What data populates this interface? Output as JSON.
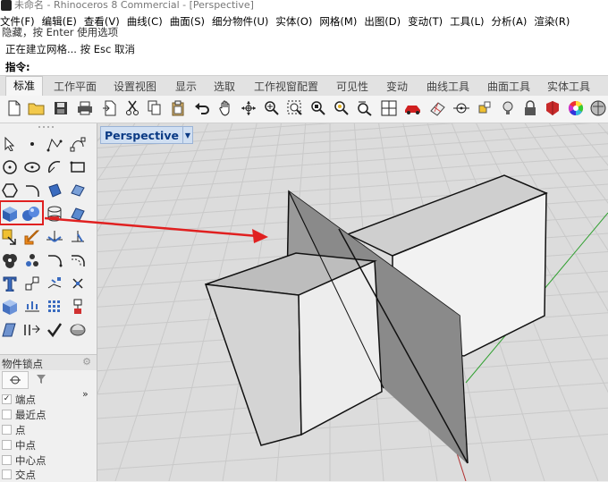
{
  "window": {
    "title": "未命名 - Rhinoceros 8 Commercial - [Perspective]"
  },
  "menu": [
    "文件(F)",
    "编辑(E)",
    "查看(V)",
    "曲线(C)",
    "曲面(S)",
    "细分物件(U)",
    "实体(O)",
    "网格(M)",
    "出图(D)",
    "变动(T)",
    "工具(L)",
    "分析(A)",
    "渲染(R)"
  ],
  "command": {
    "history_1": "隐藏，按 Enter 使用选项",
    "history_2": "正在建立网格... 按 Esc 取消",
    "prompt": "指令:"
  },
  "tabs": [
    "标准",
    "工作平面",
    "设置视图",
    "显示",
    "选取",
    "工作视窗配置",
    "可见性",
    "变动",
    "曲线工具",
    "曲面工具",
    "实体工具"
  ],
  "toolbar_icons": [
    "new-file-icon",
    "open-folder-icon",
    "save-icon",
    "print-icon",
    "import-icon",
    "cut-icon",
    "copy-icon",
    "paste-icon",
    "undo-icon",
    "pan-hand-icon",
    "rotate-view-icon",
    "zoom-icon",
    "zoom-window-icon",
    "zoom-extents-icon",
    "zoom-selected-icon",
    "four-viewports-icon",
    "car-icon",
    "grid-icon",
    "cplane-icon",
    "osnap-icon",
    "light-bulb-icon",
    "lock-icon",
    "material-icon",
    "color-wheel-icon",
    "render-sphere-icon"
  ],
  "object_snap": {
    "title": "物件锁点",
    "options": [
      {
        "label": "端点",
        "checked": true
      },
      {
        "label": "最近点",
        "checked": false
      },
      {
        "label": "点",
        "checked": false
      },
      {
        "label": "中点",
        "checked": false
      },
      {
        "label": "中心点",
        "checked": false
      },
      {
        "label": "交点",
        "checked": false
      }
    ],
    "more": "»"
  },
  "viewport": {
    "name": "Perspective"
  },
  "colors": {
    "viewport_bg": "#dcdcdc",
    "grid_line": "#c9c9c9",
    "axis_x": "#b03030",
    "axis_y": "#30a030",
    "annotation": "#e02020",
    "vp_label": "#0a3a84"
  }
}
